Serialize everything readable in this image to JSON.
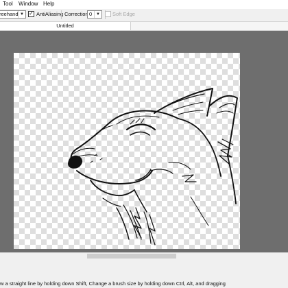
{
  "menu": {
    "tool": "Tool",
    "window": "Window",
    "help": "Help"
  },
  "toolbar": {
    "mode_select": {
      "value": "reehand"
    },
    "antialiasing": {
      "label": "AntiAliasing",
      "checked": true
    },
    "correction": {
      "label": "Correction",
      "value": "0"
    },
    "soft_edge": {
      "label": "Soft Edge",
      "checked": false,
      "enabled": false
    }
  },
  "document": {
    "tab_title": "Untitled"
  },
  "canvas": {
    "background": "transparent-checkerboard",
    "content": "wolf-head-sketch"
  },
  "status": {
    "hint": "w a straight line by holding down Shift, Change a brush size by holding down Ctrl, Alt, and dragging"
  },
  "colors": {
    "workspace": "#6e6e6e",
    "toolbar": "#f0f0f0"
  }
}
